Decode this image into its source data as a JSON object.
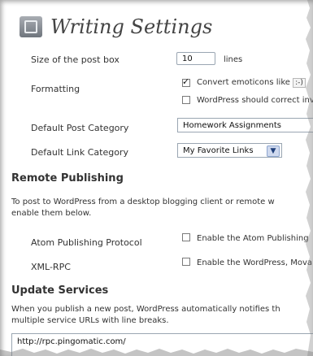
{
  "header": {
    "title": "Writing Settings",
    "icon": "writing-settings-icon"
  },
  "fields": {
    "post_box": {
      "label": "Size of the post box",
      "value": "10",
      "suffix": "lines"
    },
    "formatting": {
      "label": "Formatting",
      "opt1": {
        "checked": true,
        "text": "Convert emoticons like ",
        "kbd": ":-)"
      },
      "opt2": {
        "checked": false,
        "text": "WordPress should correct inv"
      }
    },
    "default_post_category": {
      "label": "Default Post Category",
      "value": "Homework Assignments"
    },
    "default_link_category": {
      "label": "Default Link Category",
      "value": "My Favorite Links"
    }
  },
  "remote_publishing": {
    "heading": "Remote Publishing",
    "description_line1": "To post to WordPress from a desktop blogging client or remote w",
    "description_line2": "enable them below.",
    "atom": {
      "label": "Atom Publishing Protocol",
      "checked": false,
      "option": "Enable the Atom Publishing"
    },
    "xmlrpc": {
      "label": "XML-RPC",
      "checked": false,
      "option": "Enable the WordPress, Mova"
    }
  },
  "update_services": {
    "heading": "Update Services",
    "description_line1": "When you publish a new post, WordPress automatically notifies th",
    "description_line2": "multiple service URLs with line breaks.",
    "url": "http://rpc.pingomatic.com/"
  },
  "colors": {
    "input_border": "#9aa6b2",
    "select_arrow": "#cfd9ee",
    "text": "#333333"
  }
}
